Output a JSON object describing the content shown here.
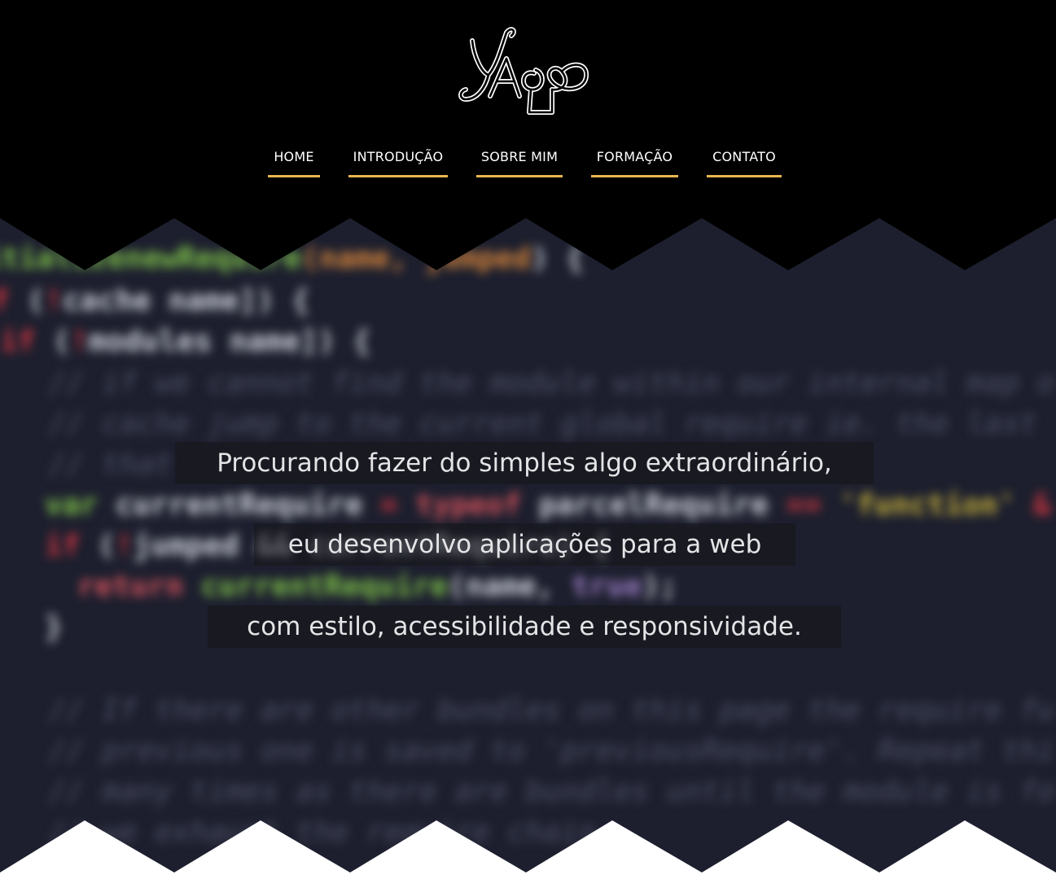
{
  "logo": {
    "text": "YAGO",
    "stroke_color": "#ffffff"
  },
  "nav": {
    "items": [
      {
        "label": "HOME"
      },
      {
        "label": "INTRODUÇÃO"
      },
      {
        "label": "SOBRE MIM"
      },
      {
        "label": "FORMAÇÃO"
      },
      {
        "label": "CONTATO"
      }
    ],
    "underline_color": "#e8b651"
  },
  "hero": {
    "lines": [
      "Procurando fazer do simples algo extraordinário,",
      "eu desenvolvo aplicações para a web",
      "com estilo, acessibilidade e responsividade."
    ],
    "background_color": "#1d1f2e"
  },
  "colors": {
    "header_bg": "#000000",
    "footer_zigzag": "#ffffff",
    "text": "#e4e4e6"
  }
}
